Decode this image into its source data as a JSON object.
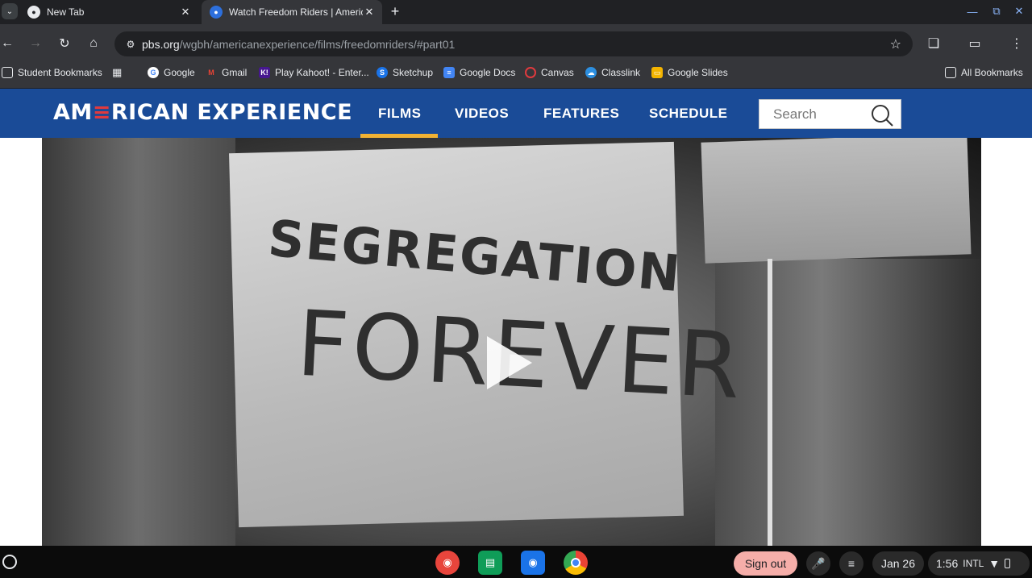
{
  "tabs": [
    {
      "title": "New Tab",
      "icon": "chrome-icon",
      "active": false
    },
    {
      "title": "Watch Freedom Riders | American Experience",
      "icon": "pbs-icon",
      "active": true
    }
  ],
  "toolbar": {
    "url_host": "pbs.org",
    "url_path": "/wgbh/americanexperience/films/freedomriders/#part01"
  },
  "bookmarks": [
    {
      "label": "Student Bookmarks",
      "icon": "folder-icon"
    },
    {
      "label": "Google",
      "icon": "google-icon"
    },
    {
      "label": "Gmail",
      "icon": "gmail-icon"
    },
    {
      "label": "Play Kahoot! - Enter...",
      "icon": "kahoot-icon"
    },
    {
      "label": "Sketchup",
      "icon": "sketchup-icon"
    },
    {
      "label": "Google Docs",
      "icon": "docs-icon"
    },
    {
      "label": "Canvas",
      "icon": "canvas-icon"
    },
    {
      "label": "Classlink",
      "icon": "classlink-icon"
    },
    {
      "label": "Google Slides",
      "icon": "slides-icon"
    }
  ],
  "all_bookmarks": "All Bookmarks",
  "site": {
    "logo_pre": "AM",
    "logo_mark": "≡",
    "logo_post": "RICAN EXPERIENCE",
    "nav": [
      "FILMS",
      "VIDEOS",
      "FEATURES",
      "SCHEDULE"
    ],
    "active_nav": "FILMS",
    "search_placeholder": "Search",
    "accent_color": "#f2b233",
    "header_color": "#1a4b97"
  },
  "video": {
    "sign_line1": "SEGREGATION",
    "sign_line2": "FOREVER"
  },
  "shelf": {
    "sign_out": "Sign out",
    "date": "Jan 26",
    "time": "1:56",
    "input_method": "INTL"
  }
}
